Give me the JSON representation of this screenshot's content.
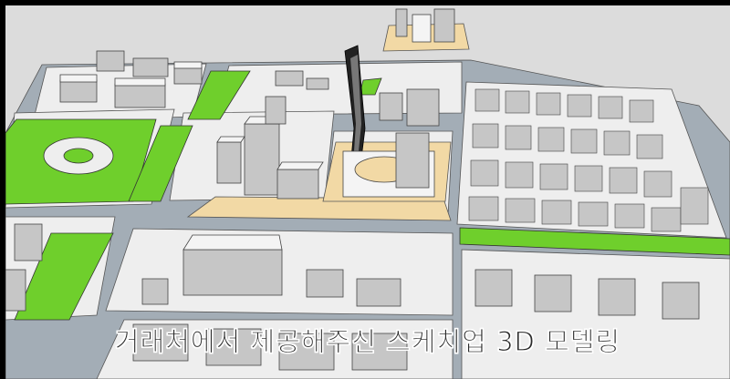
{
  "caption": {
    "text": "거래처에서 제공해주신 스케치업 3D 모델링"
  },
  "palette": {
    "ground": "#dcdcdc",
    "street": "#a3adb6",
    "block": "#eeeeee",
    "greenery": "#6fcf2c",
    "plaza": "#f2d9a5",
    "building_top": "#f4f4f4",
    "building_side": "#c6c6c6",
    "building_dark": "#8f8f8f",
    "tower": "#222222"
  }
}
